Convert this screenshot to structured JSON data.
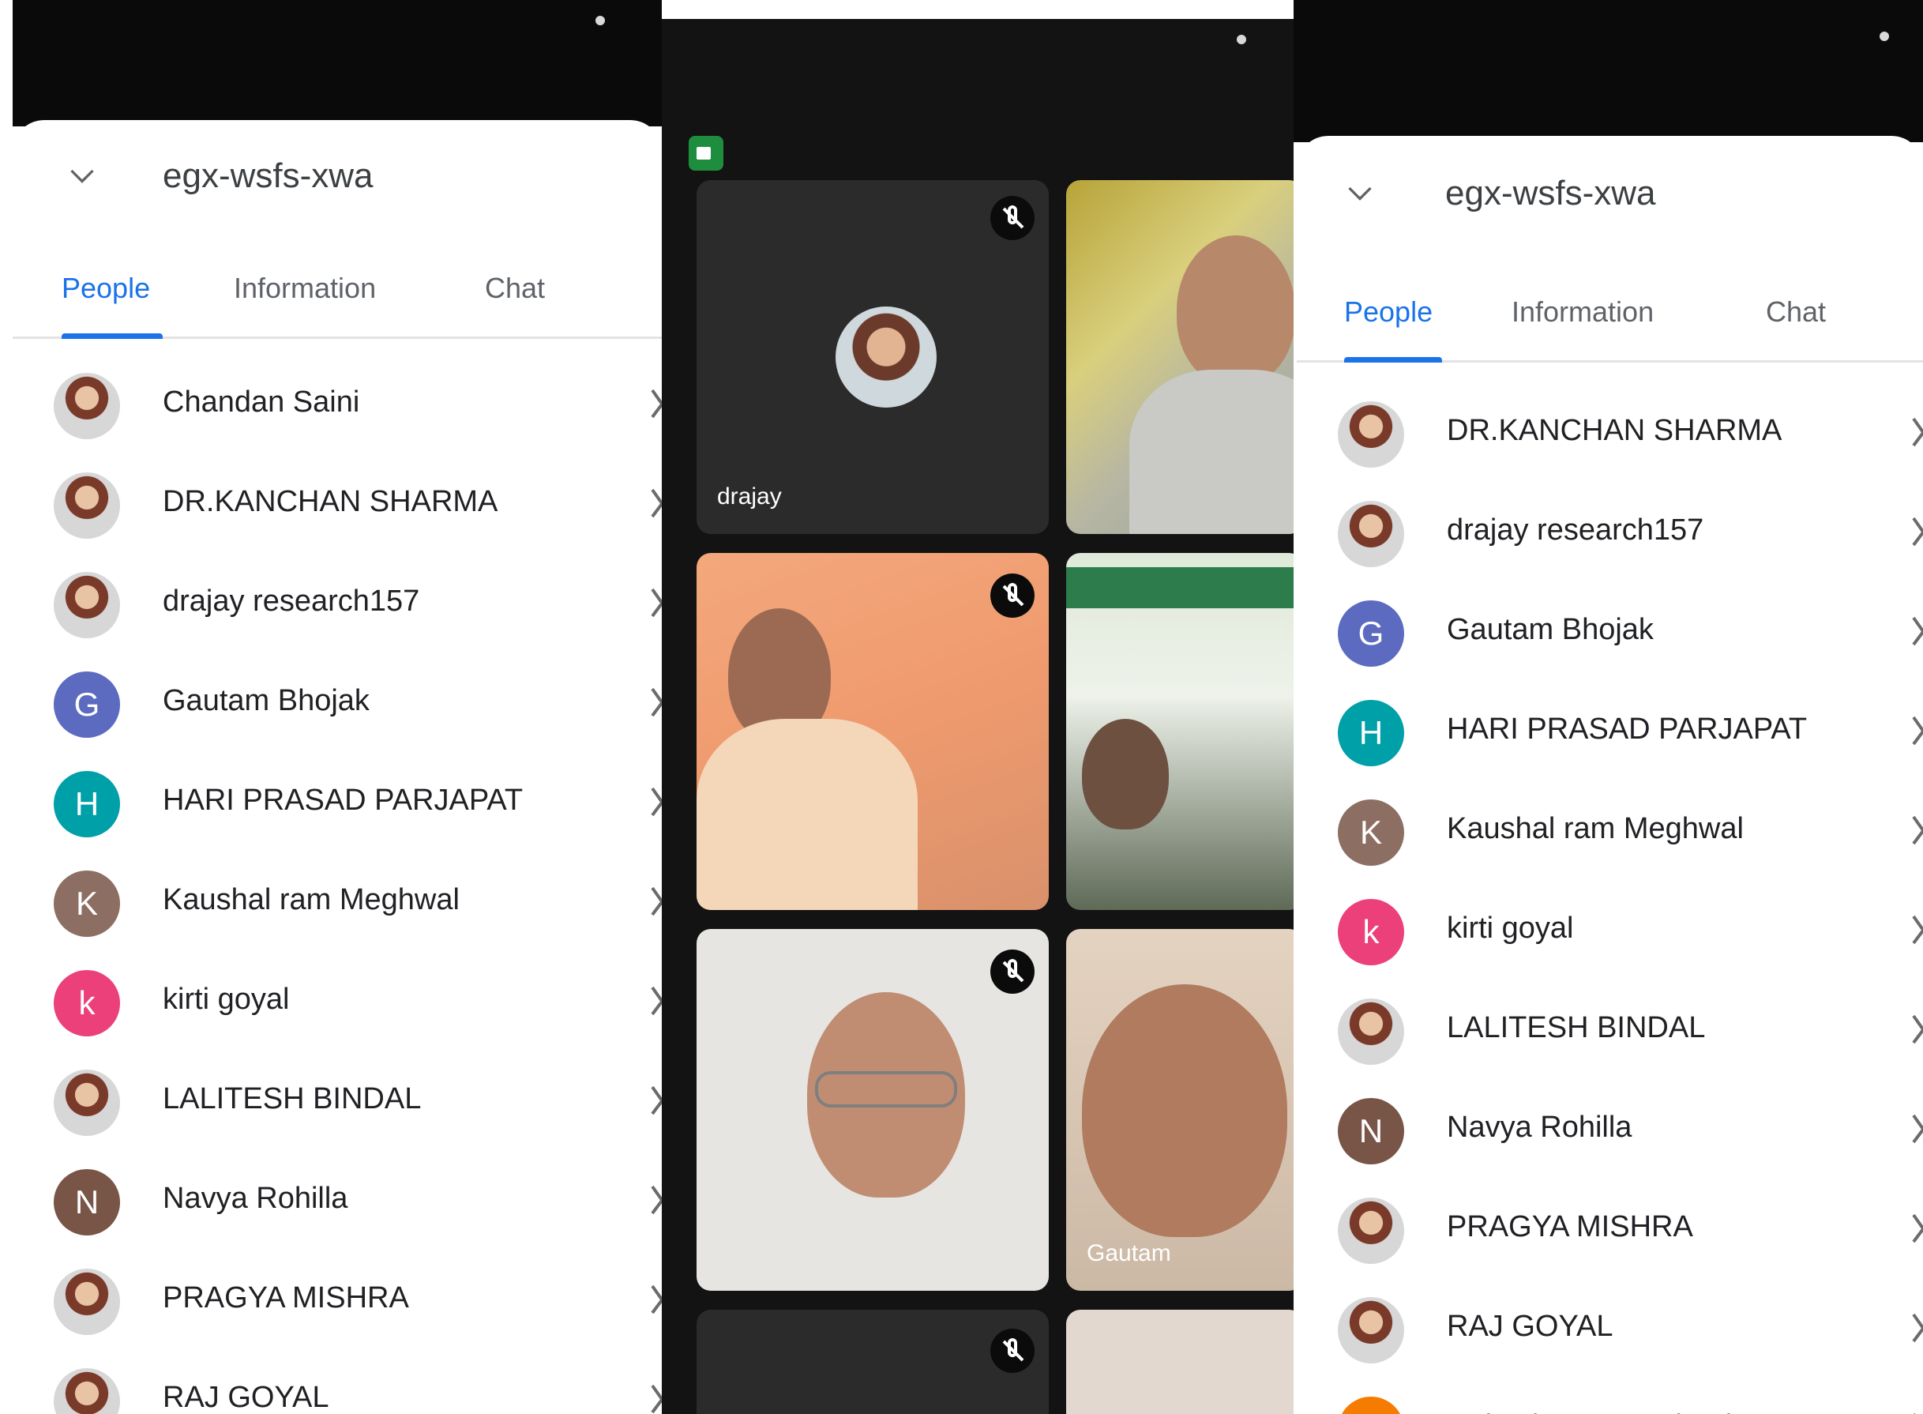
{
  "meeting_code": "egx-wsfs-xwa",
  "tabs": [
    "People",
    "Information",
    "Chat"
  ],
  "left_people": [
    {
      "name": "Chandan Saini",
      "avatar": "photo"
    },
    {
      "name": "DR.KANCHAN SHARMA",
      "avatar": "photo"
    },
    {
      "name": "drajay research157",
      "avatar": "photo"
    },
    {
      "name": "Gautam Bhojak",
      "avatar": "G",
      "color": "#5c6bc0"
    },
    {
      "name": "HARI PRASAD PARJAPAT",
      "avatar": "H",
      "color": "#00a0a8"
    },
    {
      "name": "Kaushal ram Meghwal",
      "avatar": "K",
      "color": "#8d6e63"
    },
    {
      "name": "kirti goyal",
      "avatar": "k",
      "color": "#ec407a"
    },
    {
      "name": "LALITESH BINDAL",
      "avatar": "photo"
    },
    {
      "name": "Navya Rohilla",
      "avatar": "N",
      "color": "#795548"
    },
    {
      "name": "PRAGYA MISHRA",
      "avatar": "photo"
    },
    {
      "name": "RAJ GOYAL",
      "avatar": "photo"
    }
  ],
  "right_people": [
    {
      "name": "DR.KANCHAN SHARMA",
      "avatar": "photo"
    },
    {
      "name": "drajay research157",
      "avatar": "photo"
    },
    {
      "name": "Gautam Bhojak",
      "avatar": "G",
      "color": "#5c6bc0"
    },
    {
      "name": "HARI PRASAD PARJAPAT",
      "avatar": "H",
      "color": "#00a0a8"
    },
    {
      "name": "Kaushal ram Meghwal",
      "avatar": "K",
      "color": "#8d6e63"
    },
    {
      "name": "kirti goyal",
      "avatar": "k",
      "color": "#ec407a"
    },
    {
      "name": "LALITESH BINDAL",
      "avatar": "photo"
    },
    {
      "name": "Navya Rohilla",
      "avatar": "N",
      "color": "#795548"
    },
    {
      "name": "PRAGYA MISHRA",
      "avatar": "photo"
    },
    {
      "name": "RAJ GOYAL",
      "avatar": "photo"
    },
    {
      "name": "Rakesh Kumar Chouhan",
      "avatar": "R",
      "color": "#f57c00"
    }
  ],
  "tiles": [
    {
      "label": "drajay"
    },
    {
      "label": ""
    },
    {
      "label": ""
    },
    {
      "label": ""
    },
    {
      "label": ""
    },
    {
      "label": "Gautam"
    }
  ],
  "colors": {
    "accent": "#1a73e8",
    "meet_bg": "#131313"
  }
}
